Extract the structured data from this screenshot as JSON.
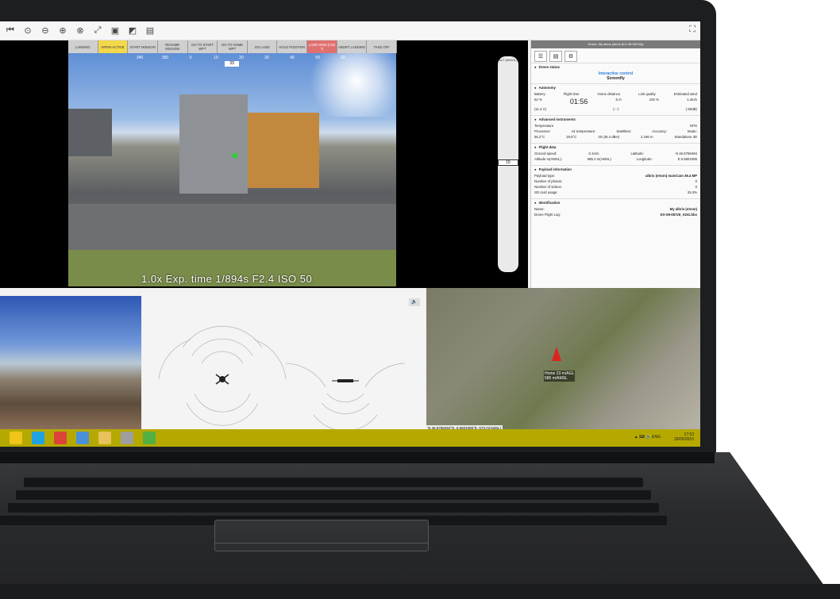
{
  "toolbar": {
    "icons": [
      "rewind-icon",
      "record-icon",
      "zoom-out-icon",
      "zoom-in-icon",
      "zoom-fit-icon",
      "auto-zoom-icon",
      "screen-icon",
      "picture-in-picture-icon",
      "image-icon"
    ],
    "fullscreen": "⛶"
  },
  "mode_bar": [
    {
      "label": "LANDING",
      "state": "normal"
    },
    {
      "label": "INTER-ACTIVE",
      "state": "active"
    },
    {
      "label": "START MISSION",
      "state": "normal"
    },
    {
      "label": "RESUME MISSION",
      "state": "normal"
    },
    {
      "label": "GO TO START WPT",
      "state": "normal"
    },
    {
      "label": "GO TO HOME WPT",
      "state": "normal"
    },
    {
      "label": "GO LAND",
      "state": "normal"
    },
    {
      "label": "HOLD POSITION",
      "state": "normal"
    },
    {
      "label": "LAND NOW (CS0 ?)",
      "state": "warn"
    },
    {
      "label": "ABORT LANDING",
      "state": "normal"
    },
    {
      "label": "TAKE OFF",
      "state": "normal"
    }
  ],
  "camera": {
    "heading_labels": [
      "340",
      "350",
      "0",
      "10",
      "20",
      "30",
      "40",
      "50",
      "60"
    ],
    "heading_value": "33",
    "info": "1.0x  Exp. time 1/894s  F2.4  ISO 50"
  },
  "altitude": {
    "label": "ALT (M/AGL)",
    "value": "15"
  },
  "panel": {
    "header": "Drone: My albris (albris (EX-08-08726))",
    "tabs": [
      "☰",
      "▤",
      "⚙"
    ],
    "drone_status": {
      "title": "Drone status",
      "mode": "Interactive control",
      "status": "Screenfly"
    },
    "autonomy": {
      "title": "Autonomy",
      "headers": [
        "Battery",
        "Flight time",
        "Home distance",
        "Link quality",
        "Estimated wind"
      ],
      "battery": "62 %",
      "battery_sub": "(11.4 V)",
      "flight_time": "01:56",
      "home_distance": "5 m",
      "home_sub": "(---)",
      "link_quality": "100 %",
      "link_sub": "(-60dB)",
      "wind": "1.4m/s"
    },
    "advanced": {
      "title": "Advanced instruments",
      "temperature": "Temperature",
      "gps": "GPS",
      "processor": "Processor:",
      "processor_val": "56.2°C",
      "air_temp": "Air temperature:",
      "air_val": "19.5°C",
      "satellites": "Satellites:",
      "sat_val": "20 (36.4 dBH)",
      "accuracy": "Accuracy:",
      "accuracy_val": "2.196 m",
      "mode": "Mode:",
      "mode_val": "Standalone 3D"
    },
    "flight_data": {
      "title": "Flight data",
      "ground_speed": "Ground speed:",
      "ground_speed_val": "0.1m/s",
      "altitude": "Altitude m(AMSL):",
      "altitude_val": "585.2 m(AMSL)",
      "latitude": "Latitude:",
      "latitude_val": "N 46.5758494",
      "longitude": "Longitude:",
      "longitude_val": "E 6.5501085"
    },
    "payload": {
      "title": "Payload information",
      "type": "Payload type:",
      "type_val": "albris (eXom) mainCam 38.4 MP",
      "photos": "Number of photos:",
      "photos_val": "0",
      "videos": "Number of videos:",
      "videos_val": "0",
      "sd": "SD card usage:",
      "sd_val": "25.3%"
    },
    "identification": {
      "title": "Identification",
      "name": "Name:",
      "name_val": "My albris (eXom)",
      "log": "Drone Flight Log:",
      "log_val": "EX-08-08726_0191.bbx"
    }
  },
  "map": {
    "coords": "N 46.5758494°N, 6.5501085°E, 573 m(AMSL)",
    "home_label": "Home 23 m/AGL",
    "home_sub": "585 m/AMSL"
  },
  "taskbar": {
    "apps": [
      {
        "name": "file-explorer-icon",
        "color": "#f0c419"
      },
      {
        "name": "store-icon",
        "color": "#1fa3e0"
      },
      {
        "name": "chrome-icon",
        "color": "#db4437"
      },
      {
        "name": "media-icon",
        "color": "#4a90d9"
      },
      {
        "name": "folder-icon",
        "color": "#e8c25a"
      },
      {
        "name": "settings-app-icon",
        "color": "#9e9e9e"
      },
      {
        "name": "xbox-icon",
        "color": "#52b043"
      }
    ],
    "tray": "▲  ⌨  🔊  ENG",
    "time": "17:53",
    "date": "26/05/2015"
  }
}
